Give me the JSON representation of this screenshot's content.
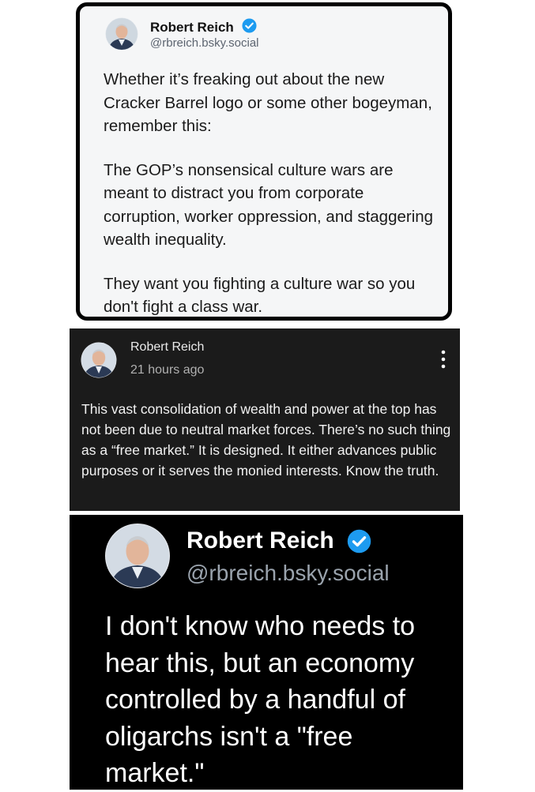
{
  "card1": {
    "author_name": "Robert Reich",
    "handle": "@rbreich.bsky.social",
    "paragraphs": [
      "Whether it’s freaking out about the new Cracker Barrel logo or some other bogeyman, remember this:",
      "The GOP’s nonsensical culture wars are meant to distract you from corporate corruption, worker oppression, and staggering wealth inequality.",
      "They want you fighting a culture war so you don't fight a class war."
    ]
  },
  "card2": {
    "author_name": "Robert Reich",
    "timestamp": "21 hours ago",
    "text": "This vast consolidation of wealth and power at the top has not been due to neutral market forces. There’s no such thing as a “free market.” It is designed. It either advances public purposes or it serves the monied interests. Know the truth."
  },
  "card3": {
    "author_name": "Robert Reich",
    "handle": "@rbreich.bsky.social",
    "text": "I don't know who needs to hear this, but an economy controlled by a handful of oligarchs isn't a \"free market.\""
  },
  "icons": {
    "verified": "verified-badge-icon",
    "more": "more-vertical-icon"
  },
  "colors": {
    "verified_blue": "#1d9bf0",
    "card1_bg": "#f5f6f7",
    "card2_bg": "#1b1b1b",
    "card3_bg": "#000000"
  }
}
